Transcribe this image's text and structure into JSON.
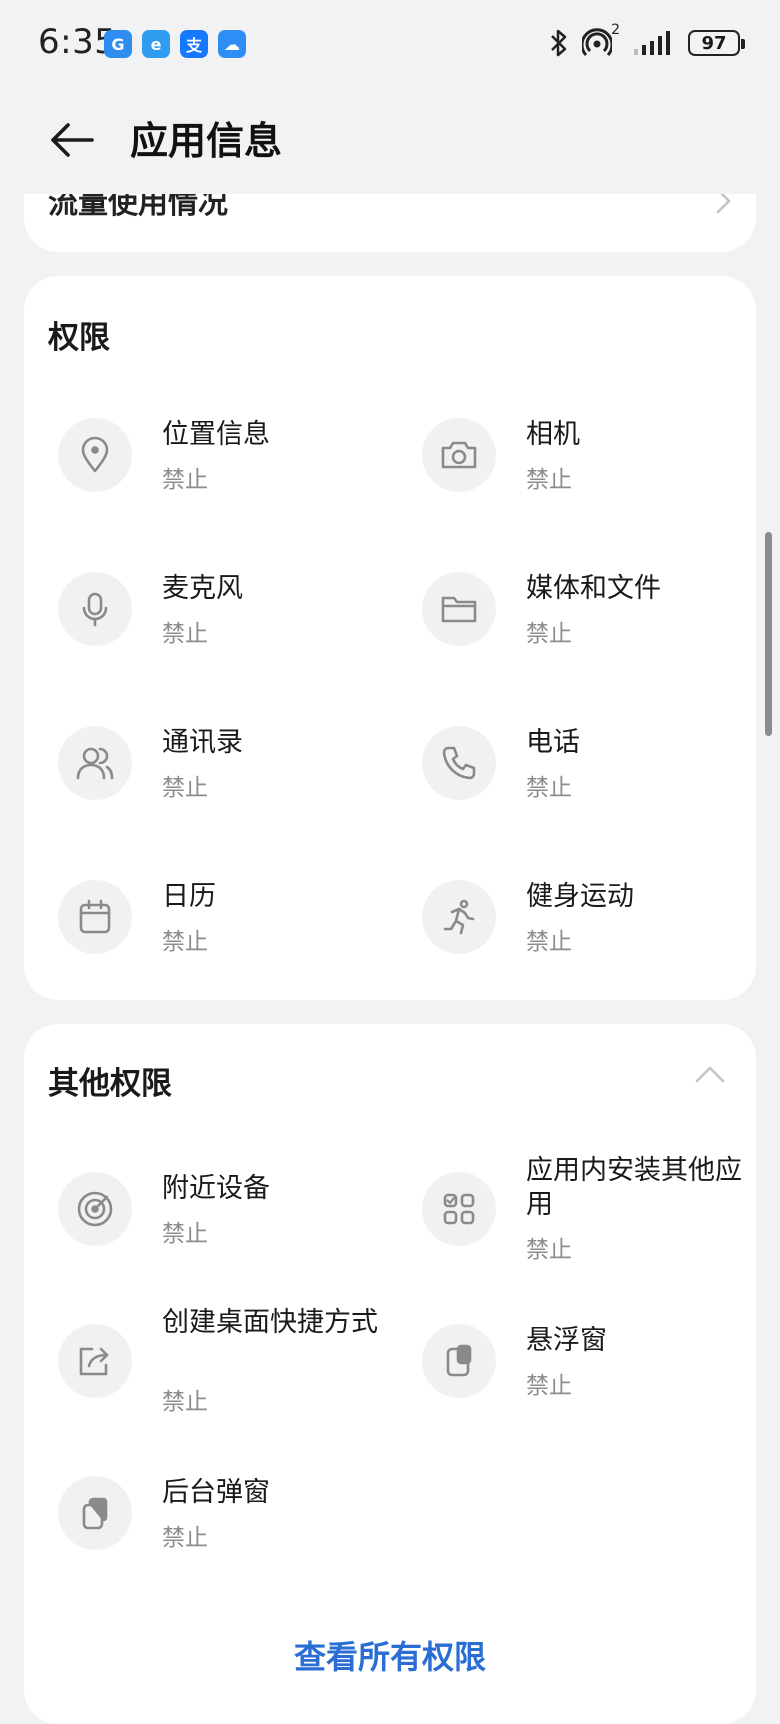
{
  "status_bar": {
    "time": "6:35",
    "apps": [
      {
        "icon": "g-app-icon",
        "glyph": "G",
        "color": "#2f8cf0"
      },
      {
        "icon": "e-app-icon",
        "glyph": "e",
        "color": "#2f9cf0"
      },
      {
        "icon": "alipay-icon",
        "glyph": "支",
        "color": "#1677ff"
      },
      {
        "icon": "weather-icon",
        "glyph": "☁",
        "color": "#2e8ef5"
      }
    ],
    "hotspot_count": "2",
    "battery": "97"
  },
  "header": {
    "title": "应用信息"
  },
  "top_card": {
    "partial_label": "流量使用情况"
  },
  "permissions": {
    "title": "权限",
    "items": [
      {
        "name": "位置信息",
        "status": "禁止",
        "icon": "location-pin-icon"
      },
      {
        "name": "相机",
        "status": "禁止",
        "icon": "camera-icon"
      },
      {
        "name": "麦克风",
        "status": "禁止",
        "icon": "microphone-icon"
      },
      {
        "name": "媒体和文件",
        "status": "禁止",
        "icon": "folder-icon"
      },
      {
        "name": "通讯录",
        "status": "禁止",
        "icon": "contacts-icon"
      },
      {
        "name": "电话",
        "status": "禁止",
        "icon": "phone-icon"
      },
      {
        "name": "日历",
        "status": "禁止",
        "icon": "calendar-icon"
      },
      {
        "name": "健身运动",
        "status": "禁止",
        "icon": "running-icon"
      }
    ]
  },
  "other_permissions": {
    "title": "其他权限",
    "items": [
      {
        "name": "附近设备",
        "status": "禁止",
        "icon": "nearby-devices-icon"
      },
      {
        "name": "应用内安装其他应用",
        "status": "禁止",
        "icon": "install-apps-icon"
      },
      {
        "name": "创建桌面快捷方式",
        "status": "禁止",
        "icon": "shortcut-icon"
      },
      {
        "name": "悬浮窗",
        "status": "禁止",
        "icon": "floating-window-icon"
      },
      {
        "name": "后台弹窗",
        "status": "禁止",
        "icon": "background-popup-icon"
      }
    ],
    "view_all": "查看所有权限"
  }
}
